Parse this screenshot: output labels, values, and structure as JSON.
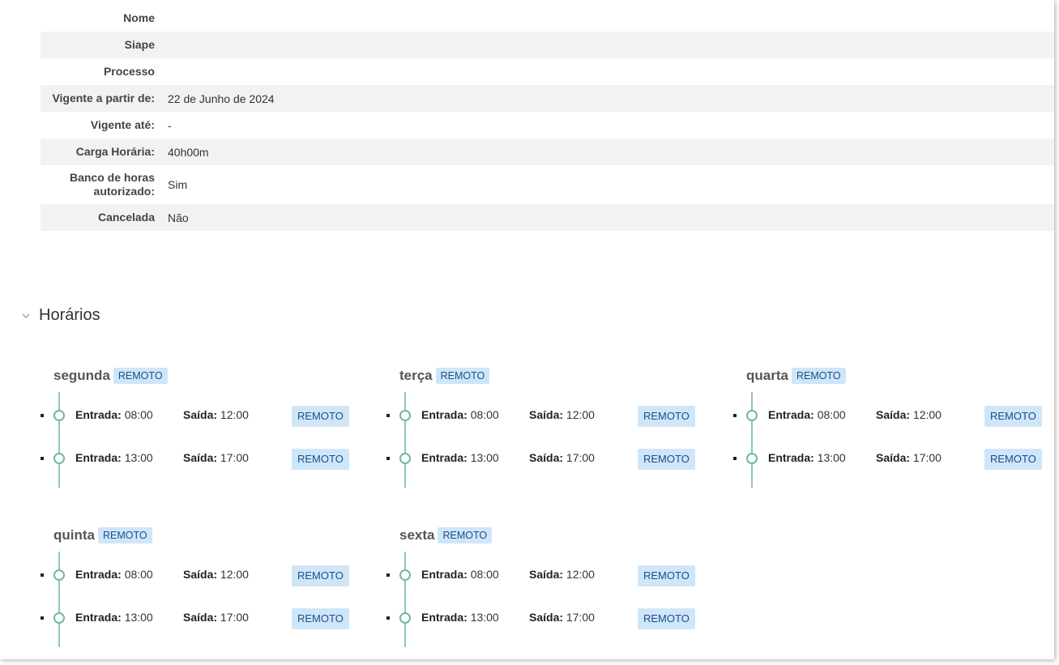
{
  "info": [
    {
      "label": "Nome",
      "value": ""
    },
    {
      "label": "Siape",
      "value": ""
    },
    {
      "label": "Processo",
      "value": ""
    },
    {
      "label": "Vigente a partir de:",
      "value": "22 de Junho de 2024"
    },
    {
      "label": "Vigente até:",
      "value": "-"
    },
    {
      "label": "Carga Horária:",
      "value": "40h00m"
    },
    {
      "label": "Banco de horas autorizado:",
      "value": "Sim"
    },
    {
      "label": "Cancelada",
      "value": "Não"
    }
  ],
  "section": {
    "title": "Horários",
    "icon": "chevron-down-icon"
  },
  "labels": {
    "entrada": "Entrada:",
    "saida": "Saída:"
  },
  "colors": {
    "tag_bg": "#cfe6f9",
    "tag_text": "#1a4f8a",
    "timeline": "#8cc9b7"
  },
  "days": [
    {
      "name": "segunda",
      "tag": "REMOTO",
      "entries": [
        {
          "entrada": "08:00",
          "saida": "12:00",
          "tag": "REMOTO"
        },
        {
          "entrada": "13:00",
          "saida": "17:00",
          "tag": "REMOTO"
        }
      ]
    },
    {
      "name": "terça",
      "tag": "REMOTO",
      "entries": [
        {
          "entrada": "08:00",
          "saida": "12:00",
          "tag": "REMOTO"
        },
        {
          "entrada": "13:00",
          "saida": "17:00",
          "tag": "REMOTO"
        }
      ]
    },
    {
      "name": "quarta",
      "tag": "REMOTO",
      "entries": [
        {
          "entrada": "08:00",
          "saida": "12:00",
          "tag": "REMOTO"
        },
        {
          "entrada": "13:00",
          "saida": "17:00",
          "tag": "REMOTO"
        }
      ]
    },
    {
      "name": "quinta",
      "tag": "REMOTO",
      "entries": [
        {
          "entrada": "08:00",
          "saida": "12:00",
          "tag": "REMOTO"
        },
        {
          "entrada": "13:00",
          "saida": "17:00",
          "tag": "REMOTO"
        }
      ]
    },
    {
      "name": "sexta",
      "tag": "REMOTO",
      "entries": [
        {
          "entrada": "08:00",
          "saida": "12:00",
          "tag": "REMOTO"
        },
        {
          "entrada": "13:00",
          "saida": "17:00",
          "tag": "REMOTO"
        }
      ]
    }
  ]
}
